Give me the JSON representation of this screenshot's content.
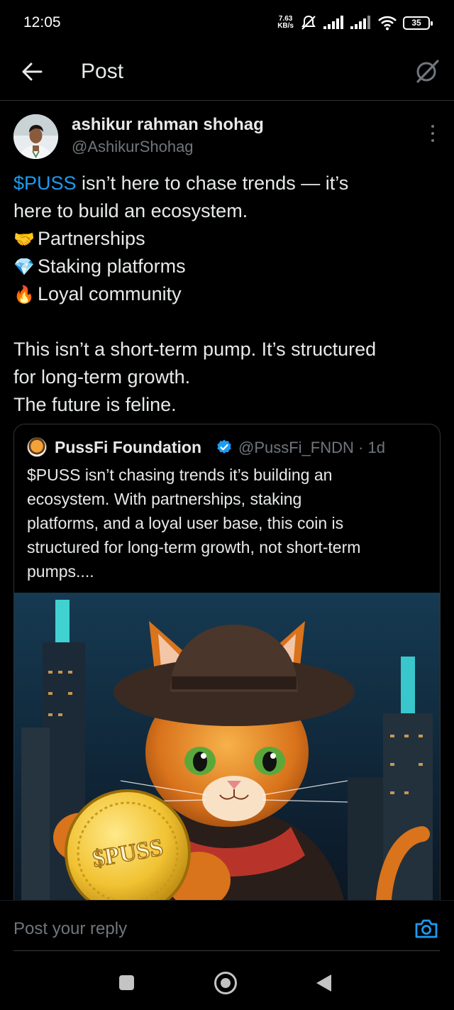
{
  "status_bar": {
    "time": "12:05",
    "net_speed_value": "7.63",
    "net_speed_unit": "KB/s",
    "battery": "35",
    "icons": [
      "mute-icon",
      "signal-icon",
      "signal-icon",
      "wifi-icon",
      "battery-icon"
    ]
  },
  "header": {
    "title": "Post",
    "back_icon": "arrow-left-icon",
    "grok_icon": "grok-icon"
  },
  "post": {
    "author_name": "ashikur rahman shohag",
    "author_handle": "@AshikurShohag",
    "cashtag": "$PUSS",
    "line1_rest": " isn’t here to chase trends — it’s",
    "line2": "here to build an ecosystem.",
    "items": [
      {
        "emoji": "🤝",
        "icon": "handshake-icon",
        "text": "Partnerships"
      },
      {
        "emoji": "💎",
        "icon": "gem-icon",
        "text": "Staking platforms"
      },
      {
        "emoji": "🔥",
        "icon": "fire-icon",
        "text": "Loyal community"
      }
    ],
    "line_after1": "This isn’t a short-term pump. It’s structured",
    "line_after2": "for long-term growth.",
    "line_after3": "The future is feline."
  },
  "quote": {
    "name": "PussFi Foundation",
    "handle": "@PussFi_FNDN",
    "separator": " · ",
    "time": "1d",
    "text_lines": [
      "$PUSS isn’t chasing trends  it’s building an",
      "ecosystem. With partnerships, staking",
      "platforms, and a loyal user base, this coin is",
      "structured for long-term growth, not short-term",
      "pumps...."
    ],
    "coin_text": "$PUSS"
  },
  "reply": {
    "placeholder": "Post your reply",
    "camera_icon": "camera-icon"
  },
  "nav": {
    "icons": [
      "recents-icon",
      "home-icon",
      "back-triangle-icon"
    ]
  }
}
